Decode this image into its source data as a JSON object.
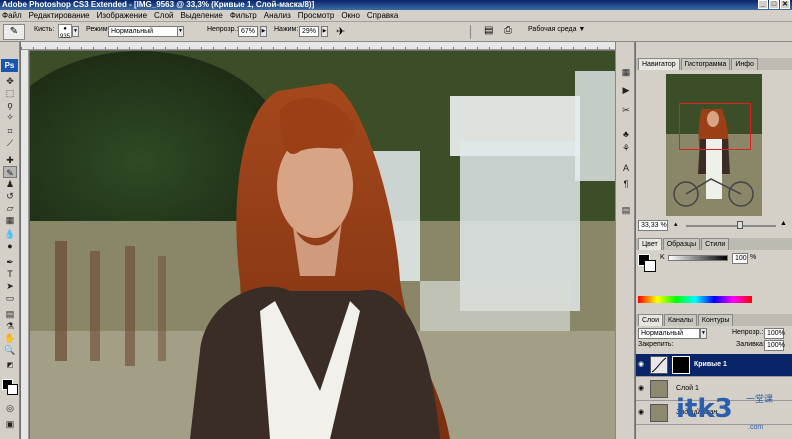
{
  "window": {
    "title": "Adobe Photoshop CS3 Extended - [IMG_9563 @ 33,3% (Кривые 1, Слой-маска/8)]",
    "buttons": [
      "_",
      "□",
      "✕"
    ]
  },
  "menu": {
    "items": [
      "Файл",
      "Редактирование",
      "Изображение",
      "Слой",
      "Выделение",
      "Фильтр",
      "Анализ",
      "Просмотр",
      "Окно",
      "Справка"
    ]
  },
  "options": {
    "brush_label": "Кисть:",
    "brush_size": "935",
    "mode_label": "Режим:",
    "mode_value": "Нормальный",
    "opacity_label": "Непрозр.:",
    "opacity_value": "67%",
    "flow_label": "Нажим:",
    "flow_value": "29%",
    "workspace_label": "Рабочая среда ▼"
  },
  "toolbox": {
    "logo": "Ps"
  },
  "navigator": {
    "tabs": [
      "Навигатор",
      "Гистограмма",
      "Инфо"
    ],
    "zoom_value": "33,33 %",
    "zoom_level": 0.6
  },
  "color_panel": {
    "tabs": [
      "Цвет",
      "Образцы",
      "Стили"
    ],
    "channel_label": "K",
    "channel_value": "100",
    "channel_unit": "%"
  },
  "layers_panel": {
    "tabs": [
      "Слои",
      "Каналы",
      "Контуры"
    ],
    "blend_mode": "Нормальный",
    "opacity_label": "Непрозр.:",
    "opacity_value": "100%",
    "lock_label": "Закрепить:",
    "fill_label": "Заливка:",
    "fill_value": "100%",
    "layers": [
      {
        "name": "Кривые 1",
        "selected": true
      },
      {
        "name": "Слой 1",
        "selected": false
      },
      {
        "name": "Задний план",
        "selected": false
      }
    ]
  },
  "watermark": {
    "brand": "itk3",
    "cn": "一堂课",
    "url": ".com"
  }
}
